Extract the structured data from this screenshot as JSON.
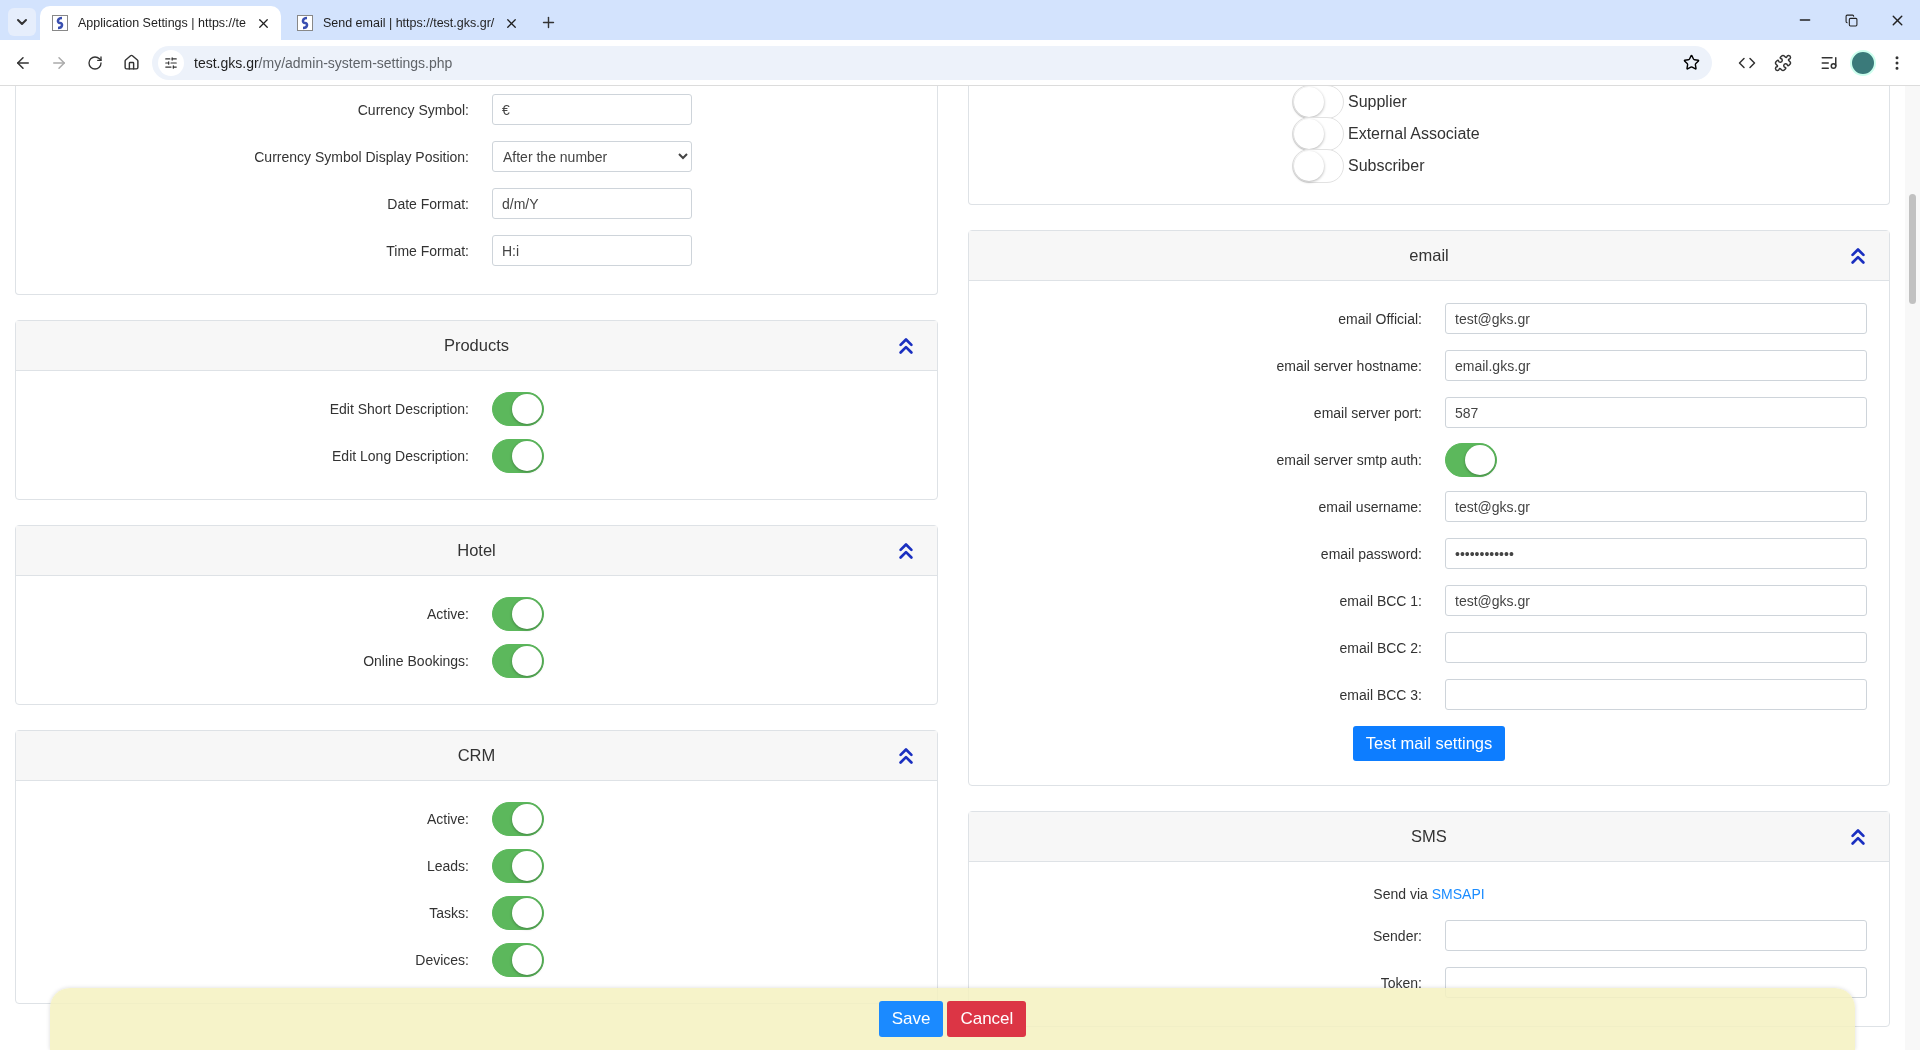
{
  "browser": {
    "tabs": [
      {
        "title": "Application Settings | https://te",
        "selected": true
      },
      {
        "title": "Send email | https://test.gks.gr/",
        "selected": false
      }
    ],
    "address": {
      "domain": "test.gks.gr",
      "path": "/my/admin-system-settings.php"
    }
  },
  "left_sections": [
    {
      "rows": [
        {
          "kind": "text",
          "label": "Currency Symbol:",
          "value": "€"
        },
        {
          "kind": "select",
          "label": "Currency Symbol Display Position:",
          "value": "After the number"
        },
        {
          "kind": "text",
          "label": "Date Format:",
          "value": "d/m/Y"
        },
        {
          "kind": "text",
          "label": "Time Format:",
          "value": "H:i"
        }
      ]
    },
    {
      "title": "Products",
      "rows": [
        {
          "kind": "toggle",
          "label": "Edit Short Description:",
          "on": true
        },
        {
          "kind": "toggle",
          "label": "Edit Long Description:",
          "on": true
        }
      ]
    },
    {
      "title": "Hotel",
      "rows": [
        {
          "kind": "toggle",
          "label": "Active:",
          "on": true
        },
        {
          "kind": "toggle",
          "label": "Online Bookings:",
          "on": true
        }
      ]
    },
    {
      "title": "CRM",
      "rows": [
        {
          "kind": "toggle",
          "label": "Active:",
          "on": true
        },
        {
          "kind": "toggle",
          "label": "Leads:",
          "on": true
        },
        {
          "kind": "toggle",
          "label": "Tasks:",
          "on": true
        },
        {
          "kind": "toggle",
          "label": "Devices:",
          "on": true
        }
      ]
    }
  ],
  "right_sections": [
    {
      "roles": [
        {
          "label": "Supplier",
          "on": false
        },
        {
          "label": "External Associate",
          "on": false
        },
        {
          "label": "Subscriber",
          "on": false
        }
      ]
    },
    {
      "title": "email",
      "rows": [
        {
          "kind": "text",
          "label": "email Official:",
          "value": "test@gks.gr"
        },
        {
          "kind": "text",
          "label": "email server hostname:",
          "value": "email.gks.gr"
        },
        {
          "kind": "text",
          "label": "email server port:",
          "value": "587"
        },
        {
          "kind": "toggle",
          "label": "email server smtp auth:",
          "on": true
        },
        {
          "kind": "text",
          "label": "email username:",
          "value": "test@gks.gr"
        },
        {
          "kind": "password",
          "label": "email password:",
          "value": "••••••••••••"
        },
        {
          "kind": "text",
          "label": "email BCC 1:",
          "value": "test@gks.gr"
        },
        {
          "kind": "text",
          "label": "email BCC 2:"
        },
        {
          "kind": "text",
          "label": "email BCC 3:"
        }
      ],
      "action": "Test mail settings"
    },
    {
      "title": "SMS",
      "intro": {
        "text": "Send via",
        "link": "SMSAPI"
      },
      "rows": [
        {
          "kind": "text",
          "label": "Sender:"
        },
        {
          "kind": "text",
          "label": "Token:"
        }
      ]
    }
  ],
  "footer": {
    "buttons": [
      {
        "label": "Save",
        "kind": "primary"
      },
      {
        "label": "Cancel",
        "kind": "danger"
      }
    ]
  }
}
